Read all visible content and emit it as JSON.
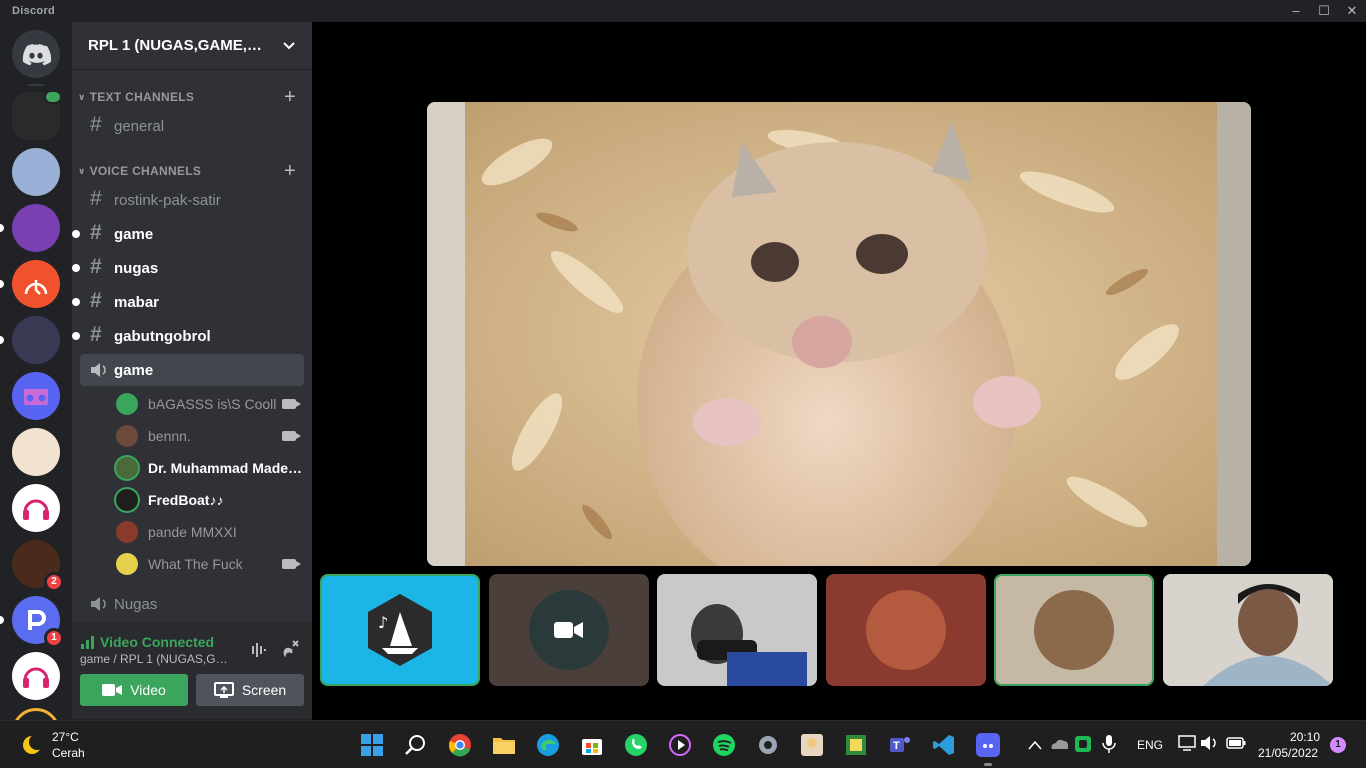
{
  "window": {
    "app_name": "Discord"
  },
  "server": {
    "name": "RPL 1 (NUGAS,GAME,GAM..."
  },
  "categories": {
    "text": "TEXT CHANNELS",
    "voice": "VOICE CHANNELS"
  },
  "text_channels": [
    {
      "name": "general"
    }
  ],
  "voice_section_channels": [
    {
      "name": "rostink-pak-satir",
      "unread": false
    },
    {
      "name": "game",
      "unread": true
    },
    {
      "name": "nugas",
      "unread": true
    },
    {
      "name": "mabar",
      "unread": true
    },
    {
      "name": "gabutngobrol",
      "unread": true
    }
  ],
  "active_voice_channel": {
    "name": "game"
  },
  "voice_users": [
    {
      "name": "bAGASSS is\\S Cooll",
      "video": true,
      "color": "#3ba55d"
    },
    {
      "name": "bennn.",
      "video": true,
      "color": "#6b4a3a"
    },
    {
      "name": "Dr. Muhammad Made m...",
      "video": false,
      "color": "#4a6a3a",
      "bright": true
    },
    {
      "name": "FredBoat♪♪",
      "video": false,
      "color": "#1f1f1f",
      "bright": true
    },
    {
      "name": "pande MMXXI",
      "video": false,
      "color": "#8a3a2a"
    },
    {
      "name": "What The Fuck",
      "video": true,
      "color": "#e6d24a"
    }
  ],
  "other_voice_channel": {
    "name": "Nugas"
  },
  "voice_connection": {
    "status": "Video Connected",
    "location": "game / RPL 1 (NUGAS,GAM...",
    "video_label": "Video",
    "screen_label": "Screen"
  },
  "servers": [
    {
      "icon": "server-video-group",
      "color": "#2a2a2a",
      "unread": false,
      "badge": ""
    },
    {
      "icon": "server-anime-girl",
      "color": "#9bb0d6",
      "unread": false,
      "badge": ""
    },
    {
      "icon": "server-purple-art",
      "color": "#7a3fb0",
      "unread": true,
      "badge": ""
    },
    {
      "icon": "server-orange-logo",
      "color": "#f0522d",
      "unread": true,
      "badge": ""
    },
    {
      "icon": "server-dark-anime",
      "color": "#3a3a55",
      "unread": true,
      "badge": ""
    },
    {
      "icon": "server-boombox",
      "color": "#5865f2",
      "unread": false,
      "badge": ""
    },
    {
      "icon": "server-blonde-anime",
      "color": "#f2e4d0",
      "unread": false,
      "badge": ""
    },
    {
      "icon": "server-music-bot",
      "color": "#ffffff",
      "unread": false,
      "badge": ""
    },
    {
      "icon": "server-streamer",
      "color": "#4a2a1a",
      "unread": false,
      "badge": "2"
    },
    {
      "icon": "server-p-logo",
      "color": "#5b6cf0",
      "unread": true,
      "badge": "1"
    },
    {
      "icon": "server-music-bot-2",
      "color": "#ffffff",
      "unread": false,
      "badge": ""
    }
  ],
  "stage": {
    "main_video": {
      "subject": "hamster-closeup"
    },
    "tiles": [
      {
        "kind": "fredboat-avatar",
        "bg": "#1bb6e5",
        "speaking": true
      },
      {
        "kind": "camera-off-avatar",
        "bg": "#4a3f3a",
        "speaking": false
      },
      {
        "kind": "video-feed",
        "bg": "#6b6b6b",
        "speaking": false
      },
      {
        "kind": "avatar-red",
        "bg": "#8a3a2e",
        "speaking": false
      },
      {
        "kind": "avatar-beige",
        "bg": "#c5b8a4",
        "speaking": true
      },
      {
        "kind": "video-feed",
        "bg": "#c9c3bd",
        "speaking": false
      }
    ]
  },
  "taskbar": {
    "weather_temp": "27°C",
    "weather_cond": "Cerah",
    "lang": "ENG",
    "time": "20:10",
    "date": "21/05/2022",
    "notifications": "1",
    "apps": [
      "start",
      "search",
      "chrome",
      "file-explorer",
      "edge",
      "store",
      "whatsapp",
      "media-player",
      "spotify",
      "settings",
      "genshin",
      "game-app",
      "teams",
      "vscode",
      "discord"
    ]
  }
}
